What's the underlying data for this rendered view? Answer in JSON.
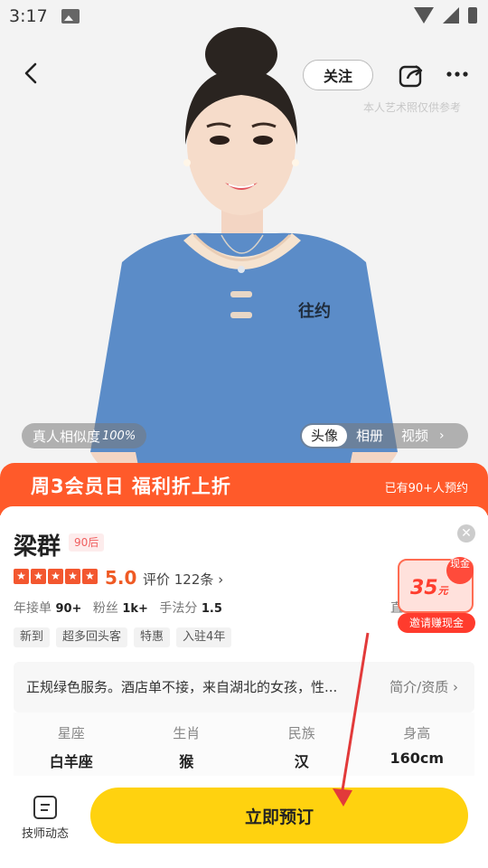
{
  "status_bar": {
    "time": "3:17"
  },
  "header": {
    "follow_label": "关注",
    "note": "本人艺术照仅供参考"
  },
  "media": {
    "similarity_label": "真人相似度",
    "similarity_value": "100%",
    "tabs": [
      {
        "label": "头像",
        "active": true
      },
      {
        "label": "相册"
      },
      {
        "label": "视频"
      }
    ],
    "tabs_arrow": "›"
  },
  "promo": {
    "title": "周3会员日  福利折上折",
    "booked": "已有90+人预约"
  },
  "profile": {
    "name": "梁群",
    "age_badge": "90后",
    "rating": 5,
    "score": "5.0",
    "reviews": "评价 122条",
    "stats": [
      {
        "label": "年接单",
        "value": "90+"
      },
      {
        "label": "粉丝",
        "value": "1k+"
      },
      {
        "label": "手法分",
        "value": "1.5"
      }
    ],
    "direct_label": "直",
    "tags": [
      "新到",
      "超多回头客",
      "特惠",
      "入驻4年"
    ]
  },
  "coupon": {
    "amount": "35",
    "unit": "元",
    "tag": "现金",
    "button": "邀请赚现金"
  },
  "intro": {
    "text": "正规绿色服务。酒店单不接，来自湖北的女孩，性...",
    "link": "简介/资质"
  },
  "info": [
    {
      "label": "星座",
      "value": "白羊座"
    },
    {
      "label": "生肖",
      "value": "猴"
    },
    {
      "label": "民族",
      "value": "汉"
    },
    {
      "label": "身高",
      "value": "160cm"
    }
  ],
  "bottom": {
    "dynamics_label": "技师动态",
    "book_label": "立即预订"
  },
  "colors": {
    "promo": "#ff5a2a",
    "accent": "#ef5a24",
    "book": "#ffd20f",
    "annotation_arrow": "#e23a3a"
  },
  "icons": [
    "back-icon",
    "share-icon",
    "more-icon",
    "close-icon",
    "star-icon",
    "dynamics-icon"
  ]
}
